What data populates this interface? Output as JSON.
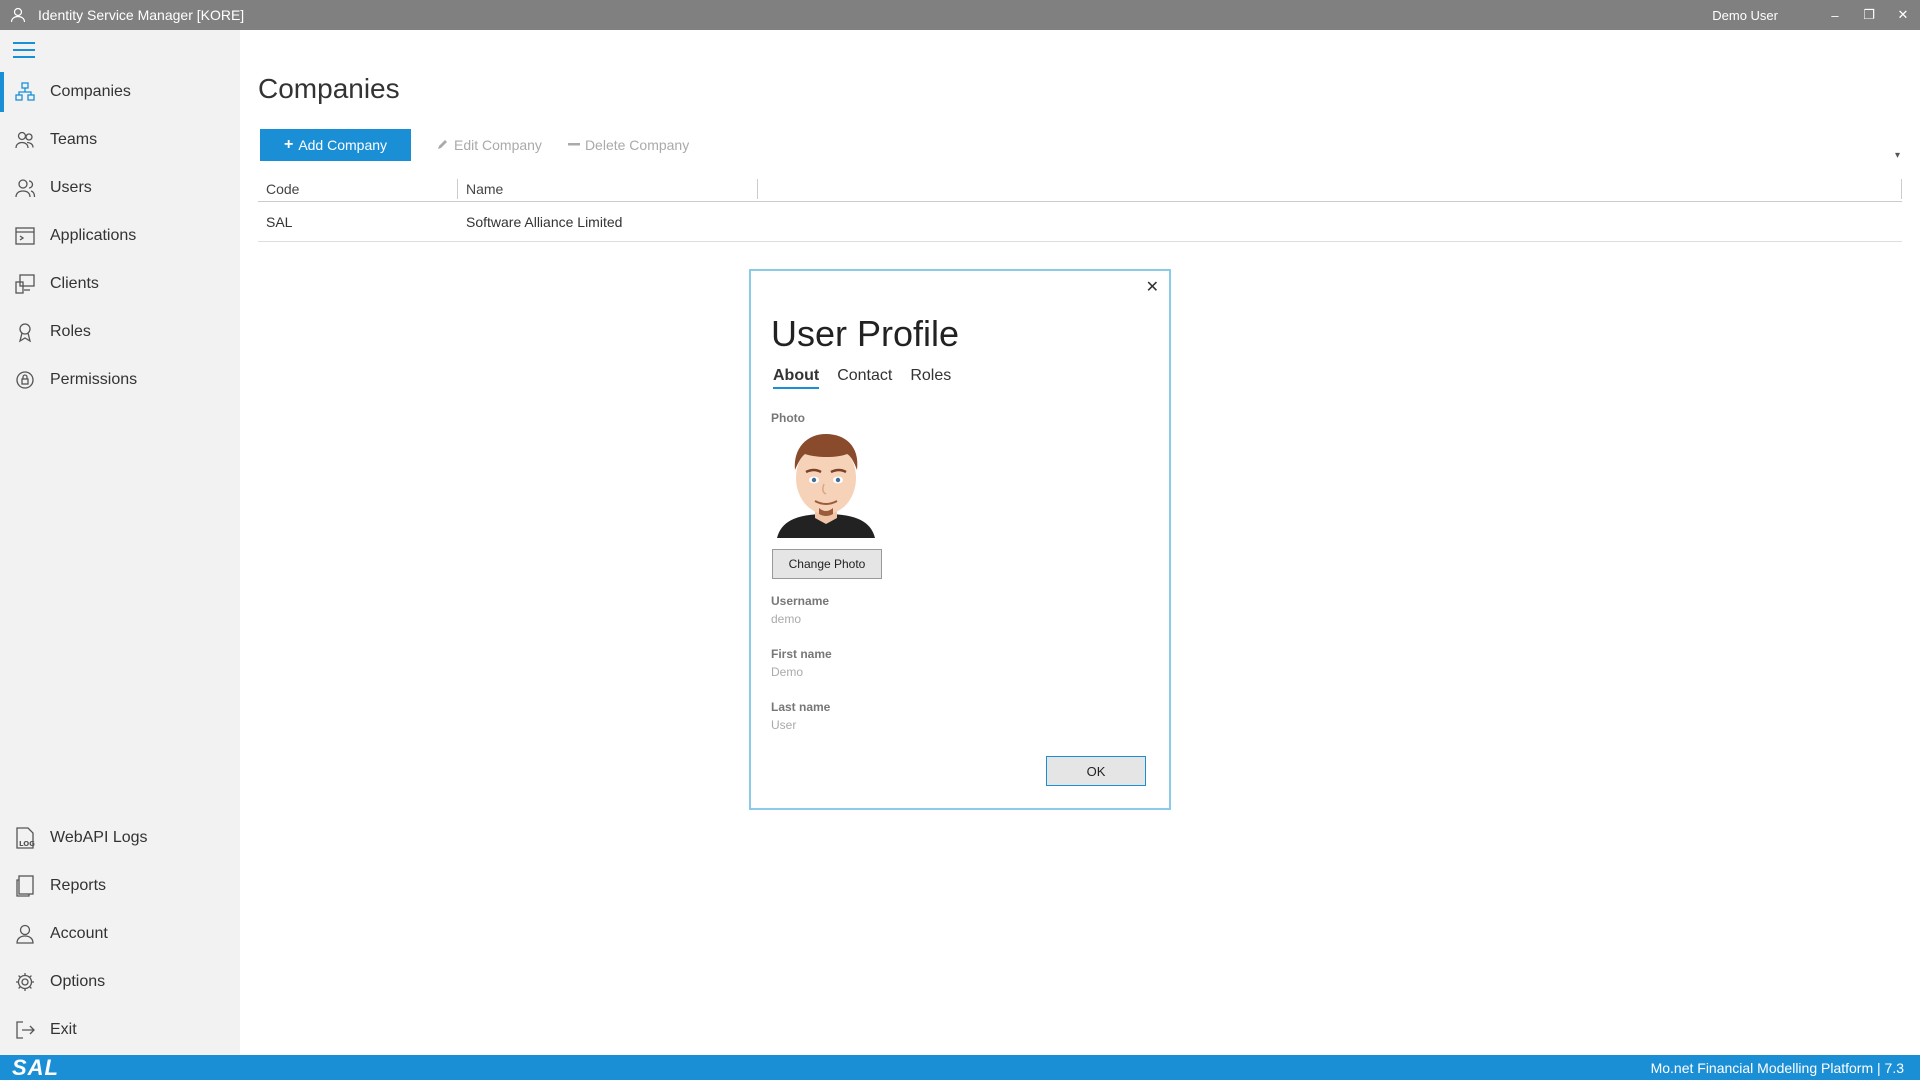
{
  "window": {
    "title": "Identity Service Manager [KORE]",
    "user": "Demo User",
    "min": "–",
    "restore": "❐",
    "close": "✕"
  },
  "sidebar": {
    "items": [
      {
        "label": "Companies",
        "icon": "companies-icon"
      },
      {
        "label": "Teams",
        "icon": "teams-icon"
      },
      {
        "label": "Users",
        "icon": "users-icon"
      },
      {
        "label": "Applications",
        "icon": "applications-icon"
      },
      {
        "label": "Clients",
        "icon": "clients-icon"
      },
      {
        "label": "Roles",
        "icon": "roles-icon"
      },
      {
        "label": "Permissions",
        "icon": "permissions-icon"
      }
    ],
    "bottom_items": [
      {
        "label": "WebAPI Logs",
        "icon": "log-icon"
      },
      {
        "label": "Reports",
        "icon": "reports-icon"
      },
      {
        "label": "Account",
        "icon": "account-icon"
      },
      {
        "label": "Options",
        "icon": "gear-icon"
      },
      {
        "label": "Exit",
        "icon": "exit-icon"
      }
    ]
  },
  "main": {
    "title": "Companies",
    "toolbar": {
      "add": "Add Company",
      "edit": "Edit Company",
      "delete": "Delete Company"
    },
    "table": {
      "headers": [
        "Code",
        "Name"
      ],
      "rows": [
        {
          "code": "SAL",
          "name": "Software Alliance Limited"
        }
      ]
    }
  },
  "dialog": {
    "title": "User Profile",
    "tabs": [
      "About",
      "Contact",
      "Roles"
    ],
    "photo_label": "Photo",
    "change_photo": "Change Photo",
    "username_label": "Username",
    "username": "demo",
    "first_name_label": "First name",
    "first_name": "Demo",
    "last_name_label": "Last name",
    "last_name": "User",
    "ok": "OK"
  },
  "statusbar": {
    "logo": "SAL",
    "platform": "Mo.net Financial Modelling Platform | 7.3"
  },
  "colors": {
    "accent": "#1a8fd6",
    "titlebar": "#808080",
    "sidebar": "#f2f2f2"
  }
}
